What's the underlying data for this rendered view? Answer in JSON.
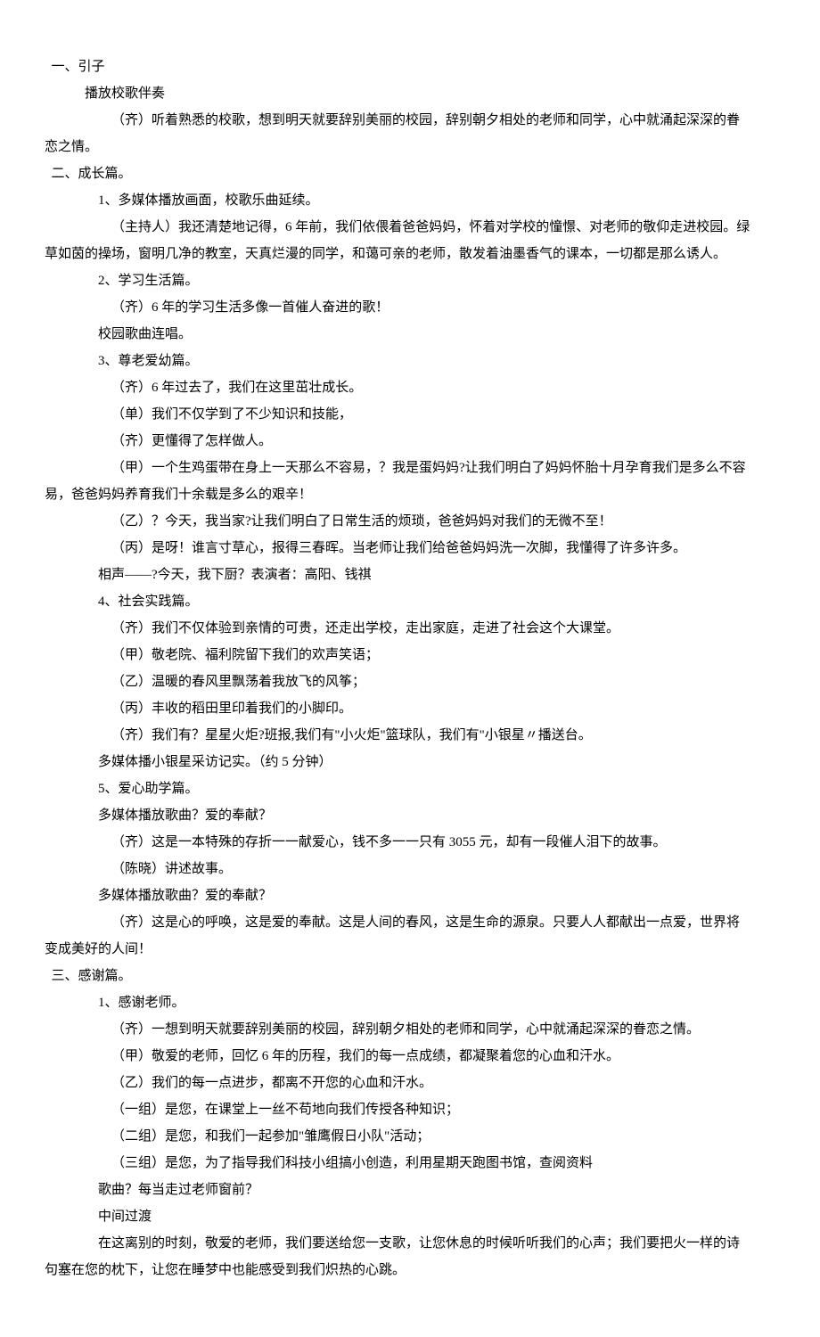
{
  "s1": {
    "h": "一、引子",
    "l1": "播放校歌伴奏",
    "l2a": "（齐）听着熟悉的校歌，想到明天就要辞别美丽的校园，辞别朝夕相处的老师和同学，心中就涌起深深的眷",
    "l2b": "恋之情。"
  },
  "s2": {
    "h": "二、成长篇。",
    "p1": {
      "h": "1、多媒体播放画面，校歌乐曲延续。",
      "l1a": "（主持人）我还清楚地记得，6 年前，我们依偎着爸爸妈妈，怀着对学校的憧憬、对老师的敬仰走进校园。绿",
      "l1b": "草如茵的操场，窗明几净的教室，天真烂漫的同学，和蔼可亲的老师，散发着油墨香气的课本，一切都是那么诱人。"
    },
    "p2": {
      "h": "2、学习生活篇。",
      "l1": "（齐）6 年的学习生活多像一首催人奋进的歌！",
      "l2": "校园歌曲连唱。"
    },
    "p3": {
      "h": "3、尊老爱幼篇。",
      "l1": "（齐）6 年过去了，我们在这里茁壮成长。",
      "l2": "（单）我们不仅学到了不少知识和技能，",
      "l3": "（齐）更懂得了怎样做人。",
      "l4a": "（甲）一个生鸡蛋带在身上一天那么不容易，？我是蛋妈妈?让我们明白了妈妈怀胎十月孕育我们是多么不容",
      "l4b": "易，爸爸妈妈养育我们十余载是多么的艰辛！",
      "l5": "（乙）？今天，我当家?让我们明白了日常生活的烦琐，爸爸妈妈对我们的无微不至！",
      "l6": "（丙）是呀！谁言寸草心，报得三春晖。当老师让我们给爸爸妈妈洗一次脚，我懂得了许多许多。",
      "l7": "相声——?今天，我下厨？表演者：高阳、钱祺"
    },
    "p4": {
      "h": "4、社会实践篇。",
      "l1": "（齐）我们不仅体验到亲情的可贵，还走出学校，走出家庭，走进了社会这个大课堂。",
      "l2": "（甲）敬老院、福利院留下我们的欢声笑语；",
      "l3": "（乙）温暖的春风里飘荡着我放飞的风筝；",
      "l4": "（丙）丰收的稻田里印着我们的小脚印。",
      "l5": "（齐）我们有？星星火炬?班报,我们有\"小火炬\"篮球队，我们有\"小银星〃播送台。",
      "l6": "多媒体播小银星采访记实。（约 5 分钟）"
    },
    "p5": {
      "h": "5、爱心助学篇。",
      "l1": "多媒体播放歌曲？爱的奉献？",
      "l2": "（齐）这是一本特殊的存折一一献爱心，钱不多一一只有 3055 元，却有一段催人泪下的故事。",
      "l3": "（陈晓）讲述故事。",
      "l4": "多媒体播放歌曲？爱的奉献？",
      "l5a": "（齐）这是心的呼唤，这是爱的奉献。这是人间的春风，这是生命的源泉。只要人人都献出一点爱，世界将",
      "l5b": "变成美好的人间！"
    }
  },
  "s3": {
    "h": "三、感谢篇。",
    "p1": {
      "h": "1、感谢老师。",
      "l1": "（齐）一想到明天就要辞别美丽的校园，辞别朝夕相处的老师和同学，心中就涌起深深的眷恋之情。",
      "l2": "（甲）敬爱的老师，回忆 6 年的历程，我们的每一点成绩，都凝聚着您的心血和汗水。",
      "l3": "（乙）我们的每一点进步，都离不开您的心血和汗水。",
      "l4": "（一组）是您，在课堂上一丝不苟地向我们传授各种知识；",
      "l5": "（二组）是您，和我们一起参加\"雏鹰假日小队\"活动；",
      "l6": "（三组）是您，为了指导我们科技小组搞小创造，利用星期天跑图书馆，查阅资料",
      "l7": "歌曲？每当走过老师窗前？",
      "l8": "中间过渡",
      "l9a": "在这离别的时刻，敬爱的老师，我们要送给您一支歌，让您休息的时候听听我们的心声；我们要把火一样的诗",
      "l9b": "句塞在您的枕下，让您在睡梦中也能感受到我们炽热的心跳。"
    }
  }
}
